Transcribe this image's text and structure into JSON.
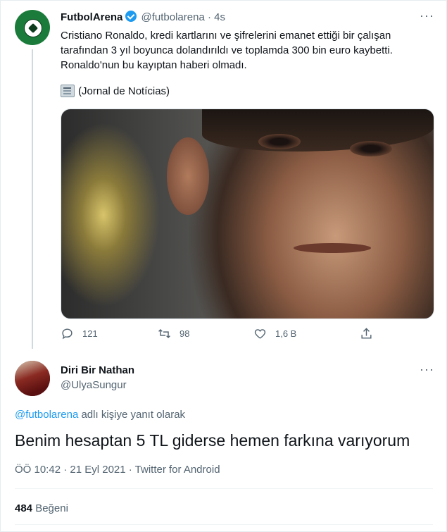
{
  "original_tweet": {
    "display_name": "FutbolArena",
    "handle": "@futbolarena",
    "dot": "·",
    "time": "4s",
    "text": "Cristiano Ronaldo, kredi kartlarını ve şifrelerini emanet ettiği bir çalışan\ntarafından 3 yıl boyunca dolandırıldı ve toplamda 300 bin euro kaybetti.\nRonaldo'nun bu kayıptan haberi olmadı.",
    "source": "(Jornal de Notícias)",
    "more_label": "···",
    "stats": {
      "replies": "121",
      "retweets": "98",
      "likes": "1,6 B"
    }
  },
  "reply_tweet": {
    "display_name": "Diri Bir Nathan",
    "handle": "@UlyaSungur",
    "more_label": "···",
    "replying_to_mention": "@futbolarena",
    "replying_to_suffix": " adlı kişiye yanıt olarak",
    "text": "Benim hesaptan 5 TL giderse hemen farkına varıyorum",
    "meta": "ÖÖ 10:42 · 21 Eyl 2021 · Twitter for Android",
    "like_count": "484",
    "like_label": "Beğeni"
  },
  "icons": [
    "verified-badge-icon",
    "newspaper-icon",
    "reply-icon",
    "retweet-icon",
    "like-icon",
    "share-icon",
    "more-icon"
  ],
  "colors": {
    "accent": "#1d9bf0",
    "secondary_text": "#536471",
    "primary_text": "#0f1419",
    "divider": "#eff3f4"
  }
}
